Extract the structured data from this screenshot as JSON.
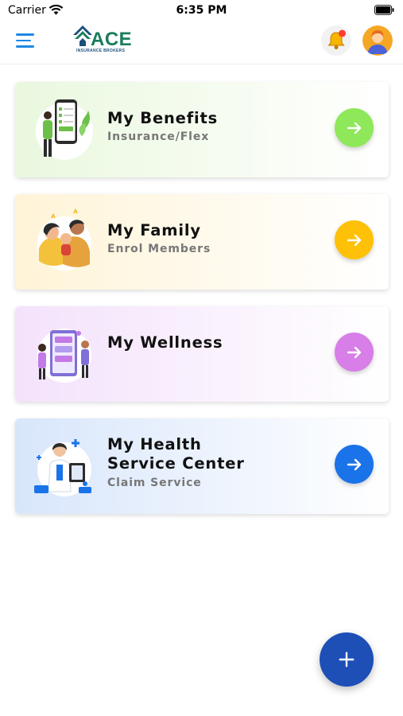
{
  "status_bar": {
    "carrier": "Carrier",
    "time": "6:35 PM"
  },
  "header": {
    "logo_text": "ACE",
    "logo_subtitle": "INSURANCE BROKERS",
    "icons": [
      "menu-icon",
      "bell-icon",
      "avatar"
    ],
    "has_notification": true
  },
  "cards": [
    {
      "title": "My Benefits",
      "subtitle": "Insurance/Flex",
      "accent": "#8ee85a",
      "illustration": "phone-benefits-illustration"
    },
    {
      "title": "My Family",
      "subtitle": "Enrol Members",
      "accent": "#ffc107",
      "illustration": "family-illustration"
    },
    {
      "title": "My Wellness",
      "subtitle": "",
      "accent": "#d77ee8",
      "illustration": "wellness-illustration"
    },
    {
      "title": "My Health\nService Center",
      "subtitle": "Claim Service",
      "accent": "#1a73e8",
      "illustration": "doctor-illustration"
    }
  ],
  "fab": {
    "icon": "plus-icon",
    "color": "#1d4fb7"
  },
  "colors": {
    "menu": "#1e88e5",
    "brand_green": "#1b7d5a",
    "notification_dot": "#ff3b30"
  }
}
